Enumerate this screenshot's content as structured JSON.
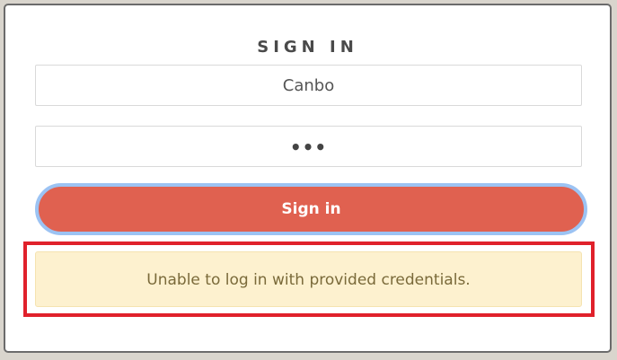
{
  "login": {
    "title": "SIGN IN",
    "username_value": "Canbo",
    "password_mask": "•••",
    "signin_label": "Sign in",
    "error_message": "Unable to log in with provided credentials."
  },
  "colors": {
    "button_bg": "#e06150",
    "button_focus_ring": "#9cc3f3",
    "alert_bg": "#fdf1cf",
    "alert_text": "#7a6a3a",
    "highlight_border": "#e0212b"
  }
}
